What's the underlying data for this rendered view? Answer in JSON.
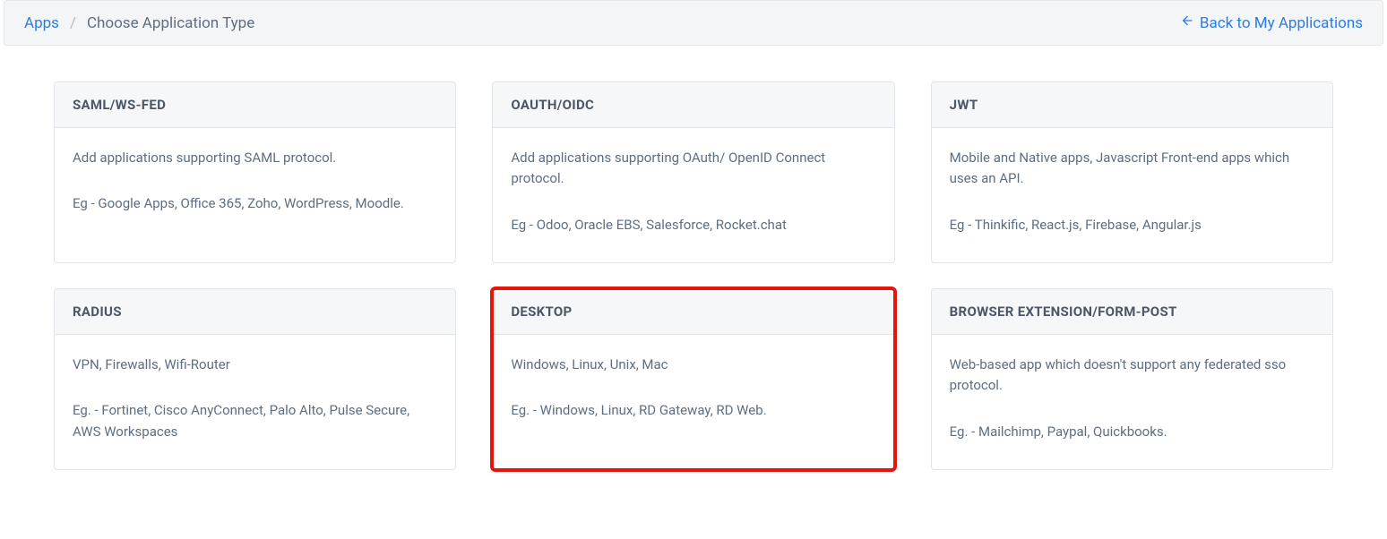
{
  "breadcrumb": {
    "root": "Apps",
    "separator": "/",
    "current": "Choose Application Type"
  },
  "back_link": "Back to My Applications",
  "cards": [
    {
      "title": "SAML/WS-FED",
      "desc": "Add applications supporting SAML protocol.",
      "example": "Eg - Google Apps, Office 365, Zoho, WordPress, Moodle.",
      "highlight": false
    },
    {
      "title": "OAUTH/OIDC",
      "desc": "Add applications supporting OAuth/ OpenID Connect protocol.",
      "example": "Eg - Odoo, Oracle EBS, Salesforce, Rocket.chat",
      "highlight": false
    },
    {
      "title": "JWT",
      "desc": "Mobile and Native apps, Javascript Front-end apps which uses an API.",
      "example": "Eg - Thinkific, React.js, Firebase, Angular.js",
      "highlight": false
    },
    {
      "title": "RADIUS",
      "desc": "VPN, Firewalls, Wifi-Router",
      "example": "Eg. - Fortinet, Cisco AnyConnect, Palo Alto, Pulse Secure, AWS Workspaces",
      "highlight": false
    },
    {
      "title": "DESKTOP",
      "desc": "Windows, Linux, Unix, Mac",
      "example": "Eg. - Windows, Linux, RD Gateway, RD Web.",
      "highlight": true
    },
    {
      "title": "BROWSER EXTENSION/FORM-POST",
      "desc": "Web-based app which doesn't support any federated sso protocol.",
      "example": "Eg. - Mailchimp, Paypal, Quickbooks.",
      "highlight": false
    }
  ]
}
